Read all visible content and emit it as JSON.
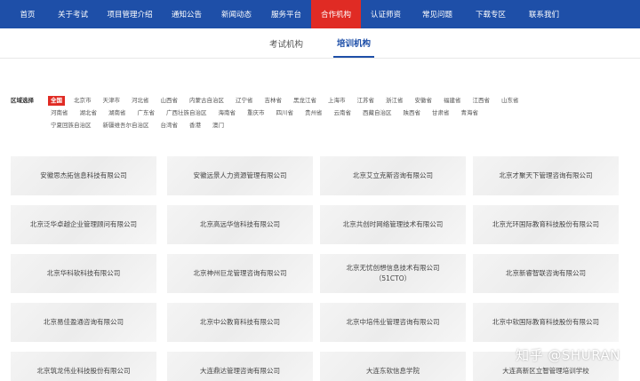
{
  "colors": {
    "nav_bg": "#1e4fa8",
    "nav_active": "#e02b24",
    "tab_active": "#1e4fa8"
  },
  "nav": [
    {
      "label": "首页"
    },
    {
      "label": "关于考试"
    },
    {
      "label": "项目管理介绍"
    },
    {
      "label": "通知公告"
    },
    {
      "label": "新闻动态"
    },
    {
      "label": "服务平台"
    },
    {
      "label": "合作机构",
      "active": true
    },
    {
      "label": "认证师资"
    },
    {
      "label": "常见问题"
    },
    {
      "label": "下载专区"
    },
    {
      "label": "联系我们"
    }
  ],
  "subtabs": [
    {
      "label": "考试机构"
    },
    {
      "label": "培训机构",
      "active": true
    }
  ],
  "region": {
    "label": "区域选择",
    "rows": [
      [
        "全国",
        "北京市",
        "天津市",
        "河北省",
        "山西省",
        "内蒙古自治区",
        "辽宁省",
        "吉林省",
        "黑龙江省",
        "上海市",
        "江苏省",
        "浙江省",
        "安徽省",
        "福建省",
        "江西省",
        "山东省"
      ],
      [
        "河南省",
        "湖北省",
        "湖南省",
        "广东省",
        "广西壮族自治区",
        "海南省",
        "重庆市",
        "四川省",
        "贵州省",
        "云南省",
        "西藏自治区",
        "陕西省",
        "甘肃省",
        "青海省"
      ],
      [
        "宁夏回族自治区",
        "新疆维吾尔自治区",
        "台湾省",
        "香港",
        "澳门"
      ]
    ],
    "active": "全国"
  },
  "cards": [
    [
      "安徽思杰拓信息科技有限公司"
    ],
    [
      "安徽远景人力资源管理有限公司"
    ],
    [
      "北京艾立克斯咨询有限公司"
    ],
    [
      "北京才聚天下管理咨询有限公司"
    ],
    [
      "北京泛华卓越企业管理顾问有限公司"
    ],
    [
      "北京高远华信科技有限公司"
    ],
    [
      "北京共创时网络管理技术有限公司"
    ],
    [
      "北京光环国际教育科技股份有限公司"
    ],
    [
      "北京华科软科技有限公司"
    ],
    [
      "北京神州巨龙管理咨询有限公司"
    ],
    [
      "北京无忧创想信息技术有限公司",
      "（51CTO）"
    ],
    [
      "北京新睿智联咨询有限公司"
    ],
    [
      "北京易佳盈通咨询有限公司"
    ],
    [
      "北京中公教育科技有限公司"
    ],
    [
      "北京中培伟业管理咨询有限公司"
    ],
    [
      "北京中软国际教育科技股份有限公司"
    ],
    [
      "北京筑龙伟业科技股份有限公司"
    ],
    [
      "大连鼎达管理咨询有限公司"
    ],
    [
      "大连东软信息学院"
    ],
    [
      "大连高新区立智管理培训学校"
    ]
  ],
  "watermark": "知乎 @SHURAN"
}
